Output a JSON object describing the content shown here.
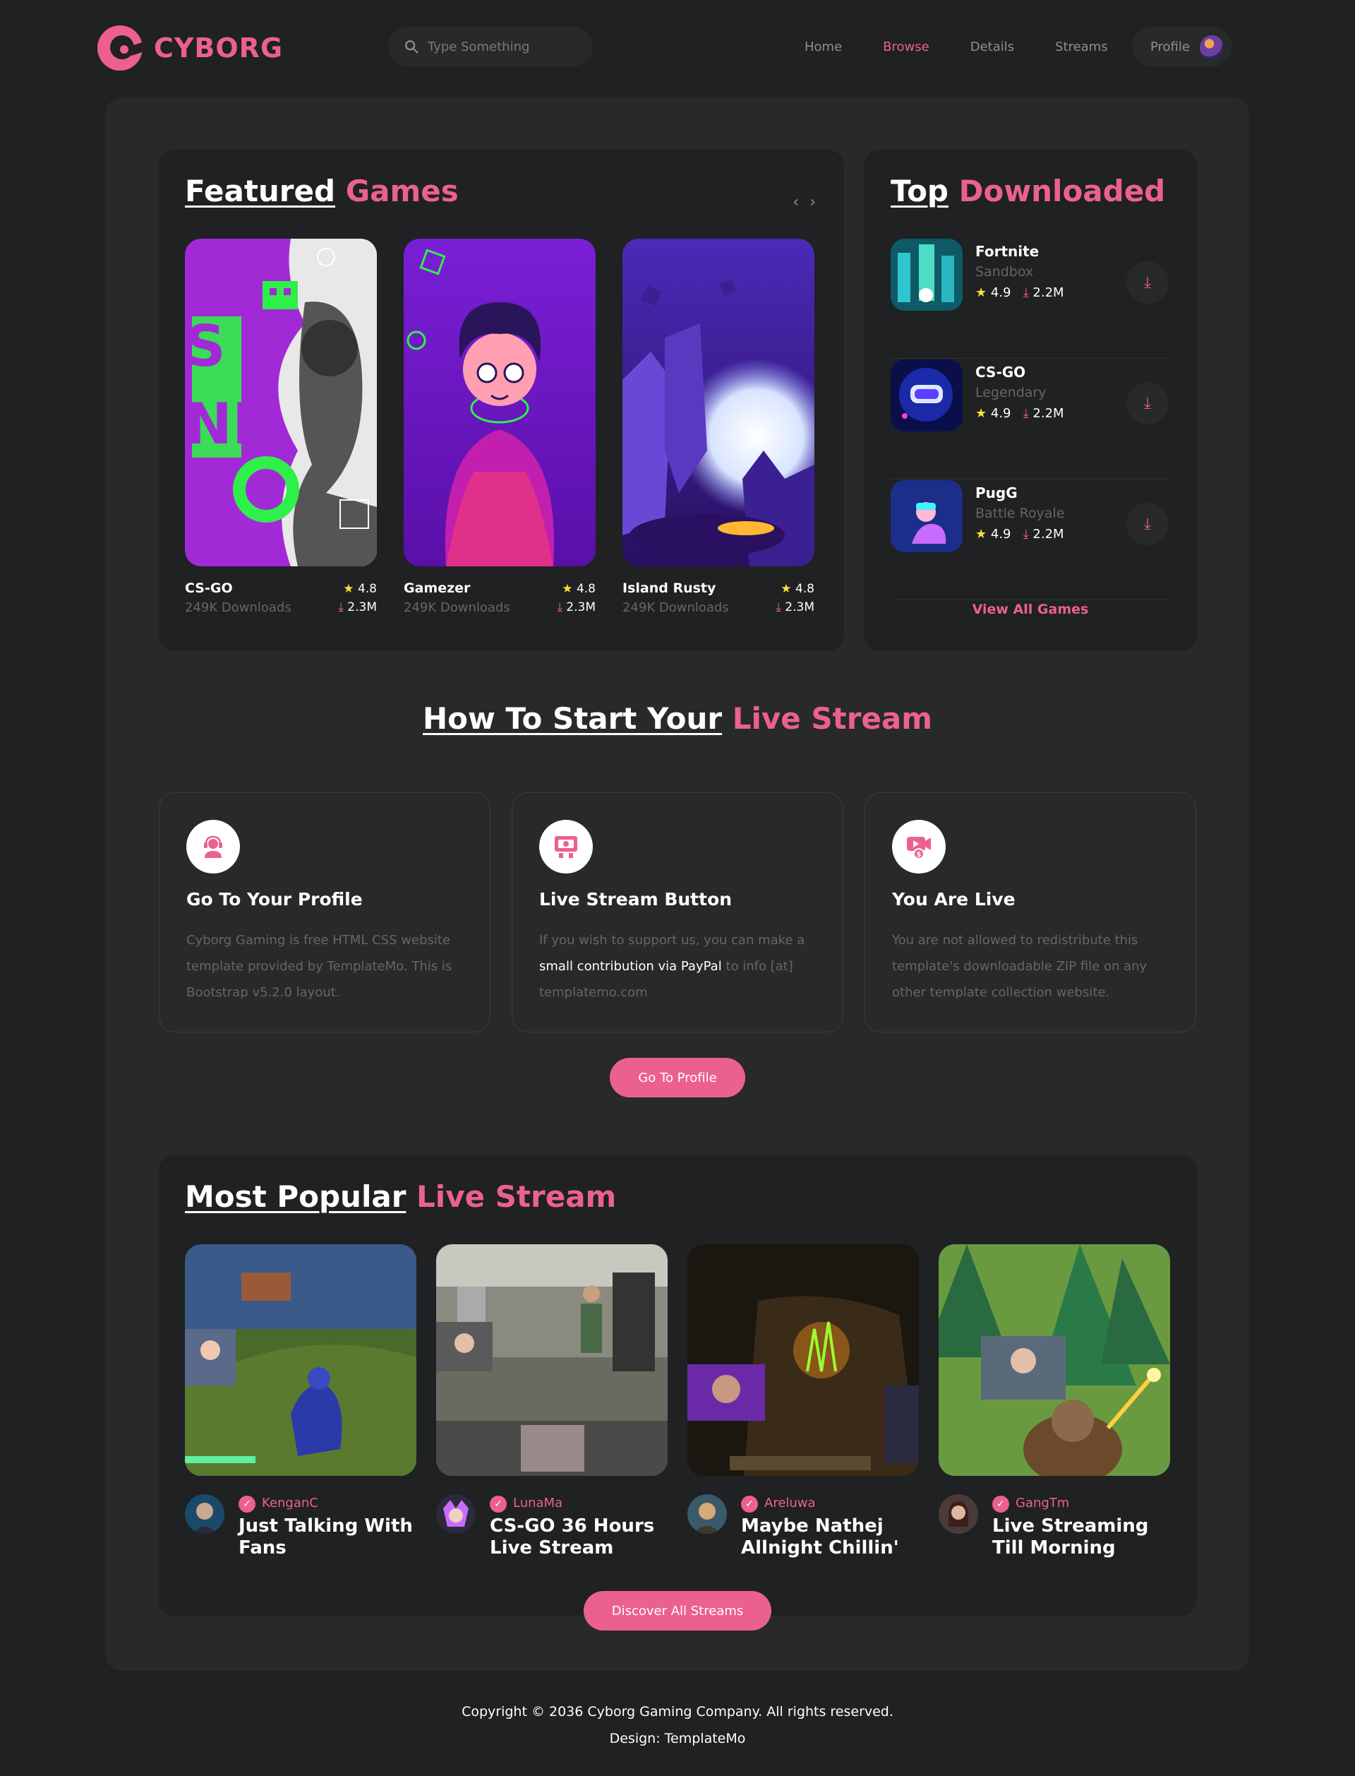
{
  "header": {
    "logo_text": "CYBORG",
    "search_placeholder": "Type Something",
    "nav": [
      "Home",
      "Browse",
      "Details",
      "Streams"
    ],
    "active_nav": "Browse",
    "profile_label": "Profile"
  },
  "featured": {
    "title_white": "Featured",
    "title_pink": "Games",
    "arrows": "‹ ›",
    "games": [
      {
        "title": "CS-GO",
        "sub": "249K Downloads",
        "rating": "4.8",
        "downloads": "2.3M"
      },
      {
        "title": "Gamezer",
        "sub": "249K Downloads",
        "rating": "4.8",
        "downloads": "2.3M"
      },
      {
        "title": "Island Rusty",
        "sub": "249K Downloads",
        "rating": "4.8",
        "downloads": "2.3M"
      }
    ]
  },
  "top_downloaded": {
    "title_white": "Top",
    "title_pink": "Downloaded",
    "items": [
      {
        "title": "Fortnite",
        "category": "Sandbox",
        "rating": "4.9",
        "downloads": "2.2M"
      },
      {
        "title": "CS-GO",
        "category": "Legendary",
        "rating": "4.9",
        "downloads": "2.2M"
      },
      {
        "title": "PugG",
        "category": "Battle Royale",
        "rating": "4.9",
        "downloads": "2.2M"
      }
    ],
    "view_all": "View All Games"
  },
  "how_to": {
    "title_white": "How To Start Your",
    "title_pink": "Live Stream",
    "steps": [
      {
        "title": "Go To Your Profile",
        "desc": "Cyborg Gaming is free HTML CSS website template provided by TemplateMo. This is Bootstrap v5.2.0 layout."
      },
      {
        "title": "Live Stream Button",
        "desc_a": "If you wish to support us, you can make a ",
        "desc_b": "small contribution via PayPal",
        "desc_c": " to info [at] templatemo.com"
      },
      {
        "title": "You Are Live",
        "desc": "You are not allowed to redistribute this template's downloadable ZIP file on any other template collection website."
      }
    ],
    "button": "Go To Profile"
  },
  "popular": {
    "title_white": "Most Popular",
    "title_pink": "Live Stream",
    "streams": [
      {
        "name": "KenganC",
        "title": "Just Talking With Fans"
      },
      {
        "name": "LunaMa",
        "title": "CS-GO 36 Hours Live Stream"
      },
      {
        "name": "Areluwa",
        "title": "Maybe Nathej Allnight Chillin'"
      },
      {
        "name": "GangTm",
        "title": "Live Streaming Till Morning"
      }
    ],
    "button": "Discover All Streams"
  },
  "footer": {
    "line1": "Copyright © 2036 Cyborg Gaming Company. All rights reserved.",
    "line2": "Design: TemplateMo"
  },
  "colors": {
    "accent": "#ec6090",
    "bg": "#1f2122",
    "panel": "#27292a",
    "star": "#fbe233"
  },
  "icons": [
    "search-icon",
    "star-icon",
    "download-icon",
    "verified-icon",
    "headset-icon",
    "live-button-icon",
    "video-camera-icon"
  ]
}
